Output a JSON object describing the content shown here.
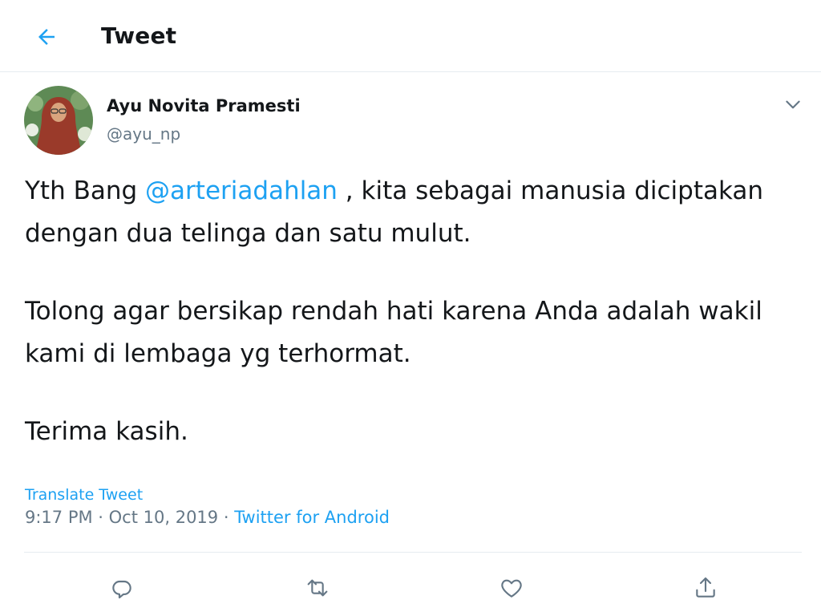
{
  "header": {
    "back_icon": "arrow-left-icon",
    "title": "Tweet"
  },
  "author": {
    "name": "Ayu Novita Pramesti",
    "handle": "@ayu_np",
    "avatar_icon": "avatar"
  },
  "tweet": {
    "para1_before": "Yth Bang ",
    "mention": "@arteriadahlan",
    "para1_after": " , kita sebagai manusia diciptakan dengan dua telinga dan satu mulut.",
    "para2": "Tolong agar bersikap rendah hati karena Anda adalah wakil kami di lembaga yg terhormat.",
    "para3": "Terima kasih."
  },
  "meta": {
    "translate": "Translate Tweet",
    "time": "9:17 PM",
    "sep1": " · ",
    "date": "Oct 10, 2019",
    "sep2": " · ",
    "source": "Twitter for Android"
  },
  "actions": {
    "reply_icon": "reply-icon",
    "retweet_icon": "retweet-icon",
    "like_icon": "heart-icon",
    "share_icon": "share-icon"
  },
  "colors": {
    "accent": "#1da1f2",
    "text": "#14171a",
    "secondary": "#657786",
    "divider": "#e6ecf0"
  }
}
